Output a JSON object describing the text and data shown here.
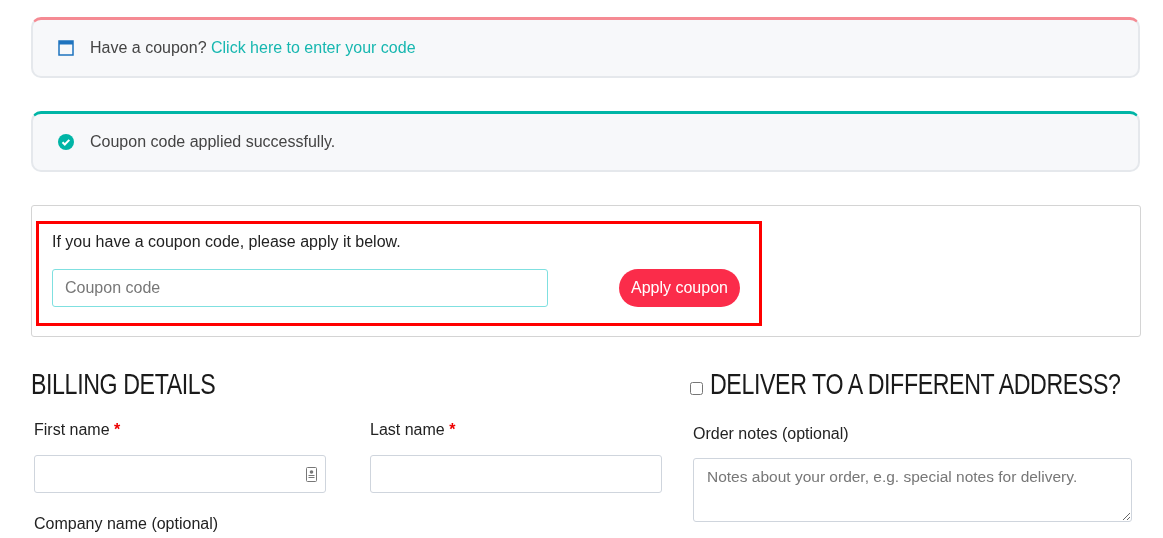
{
  "notices": [
    {
      "kind": "info",
      "text": "Have a coupon?",
      "link": "Click here to enter your code"
    },
    {
      "kind": "success",
      "text": "Coupon code applied successfully."
    }
  ],
  "coupon_form": {
    "highlighted": true,
    "intro": "If you have a coupon code, please apply it below.",
    "placeholder": "Coupon code",
    "button": "Apply coupon"
  },
  "billing": {
    "title": "BILLING DETAILS",
    "fields": [
      {
        "label": "First name",
        "required_mark": "*",
        "autofill": true
      },
      {
        "label": "Last name",
        "required_mark": "*",
        "autofill": false
      }
    ],
    "next_label": "Company name (optional)"
  },
  "shipping": {
    "title": "DELIVER TO A DIFFERENT ADDRESS?",
    "checked": false,
    "notes_label": "Order notes (optional)",
    "notes_placeholder": "Notes about your order, e.g. special notes for delivery."
  }
}
